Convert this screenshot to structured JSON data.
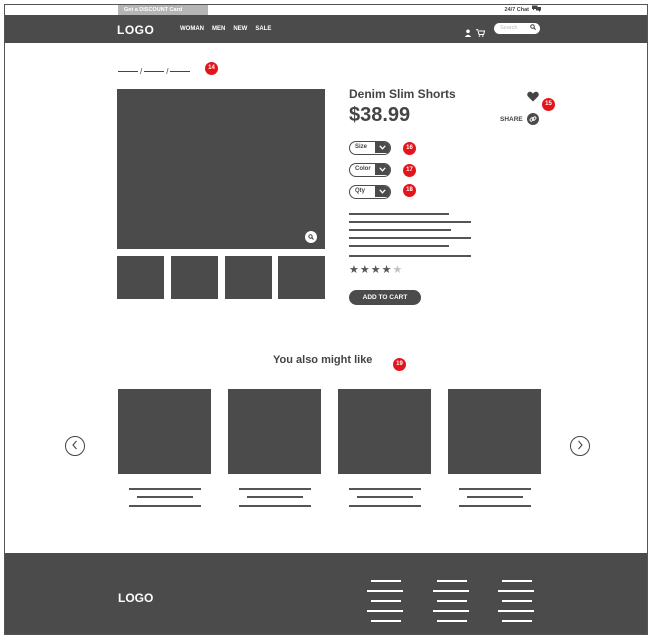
{
  "topbar": {
    "discount_label": "Get a DISCOUNT Card",
    "chat_label": "24/7 Chat"
  },
  "header": {
    "logo": "LOGO",
    "nav": [
      "WOMAN",
      "MEN",
      "NEW",
      "SALE"
    ],
    "search_placeholder": "Search",
    "icons": [
      "user-icon",
      "cart-icon",
      "search-icon"
    ]
  },
  "breadcrumb": {
    "separator": "/",
    "badge": "14"
  },
  "product": {
    "title": "Denim Slim Shorts",
    "price": "$38.99",
    "share_label": "SHARE",
    "wishlist_badge": "15",
    "selectors": [
      {
        "label": "Size",
        "badge": "16"
      },
      {
        "label": "Color",
        "badge": "17"
      },
      {
        "label": "Qty",
        "badge": "18"
      }
    ],
    "rating": 4,
    "rating_max": 5,
    "add_to_cart_label": "ADD TO CART",
    "thumbnail_count": 4
  },
  "related": {
    "title": "You also might like",
    "badge": "19",
    "card_count": 4
  },
  "footer": {
    "logo": "LOGO"
  },
  "colors": {
    "dark": "#4b4b4b",
    "badge": "#e4141b",
    "discount_bg": "#b5b5b5",
    "star_off": "#c2c2c2"
  }
}
